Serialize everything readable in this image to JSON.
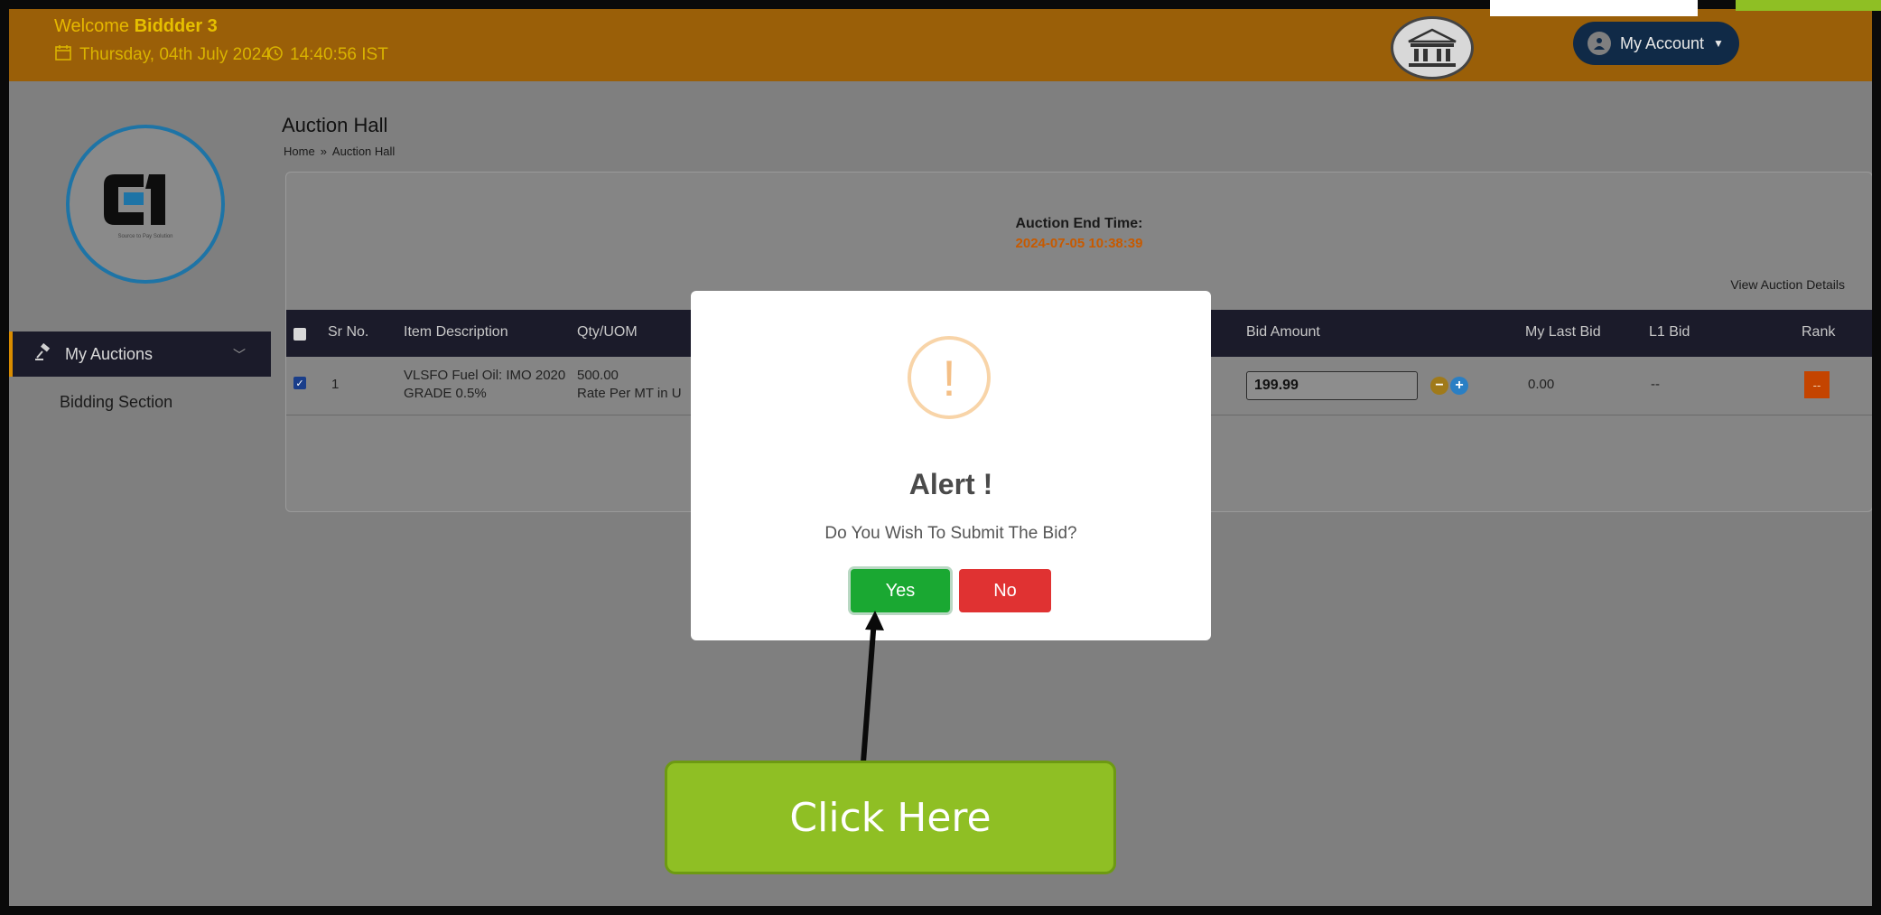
{
  "header": {
    "welcome_prefix": "Welcome",
    "user_name": "Biddder 3",
    "date": "Thursday, 04th July 2024",
    "time": "14:40:56 IST",
    "account_label": "My Account",
    "colors": {
      "bar": "#9a5f08",
      "text": "#e6c000",
      "account_bg": "#102a47"
    }
  },
  "sidebar": {
    "logo_tagline": "Source to Pay Solution",
    "items": [
      {
        "label": "My Auctions",
        "icon": "gavel-icon",
        "active": true
      },
      {
        "label": "Bidding Section",
        "active": false
      }
    ]
  },
  "page": {
    "title": "Auction Hall",
    "breadcrumb": [
      "Home",
      "Auction Hall"
    ]
  },
  "auction": {
    "end_time_label": "Auction End Time:",
    "end_time_value": "2024-07-05 10:38:39",
    "view_details_label": "View Auction Details",
    "columns": [
      "Sr No.",
      "Item Description",
      "Qty/UOM",
      "Bid Amount",
      "My Last Bid",
      "L1 Bid",
      "Rank"
    ],
    "rows": [
      {
        "sr_no": "1",
        "item_description_line1": "VLSFO Fuel Oil: IMO 2020",
        "item_description_line2": "GRADE 0.5%",
        "qty": "500.00",
        "uom": "Rate Per MT in U",
        "bid_amount": "199.99",
        "my_last_bid": "0.00",
        "l1_bid": "--",
        "rank": "--",
        "checked": true
      }
    ]
  },
  "modal": {
    "icon": "exclamation-icon",
    "title": "Alert !",
    "message": "Do You Wish To Submit The Bid?",
    "yes_label": "Yes",
    "no_label": "No",
    "colors": {
      "yes": "#1aa832",
      "no": "#e03232",
      "icon": "#f4bf86"
    }
  },
  "annotation": {
    "callout_text": "Click Here",
    "color": "#8fbf24"
  }
}
